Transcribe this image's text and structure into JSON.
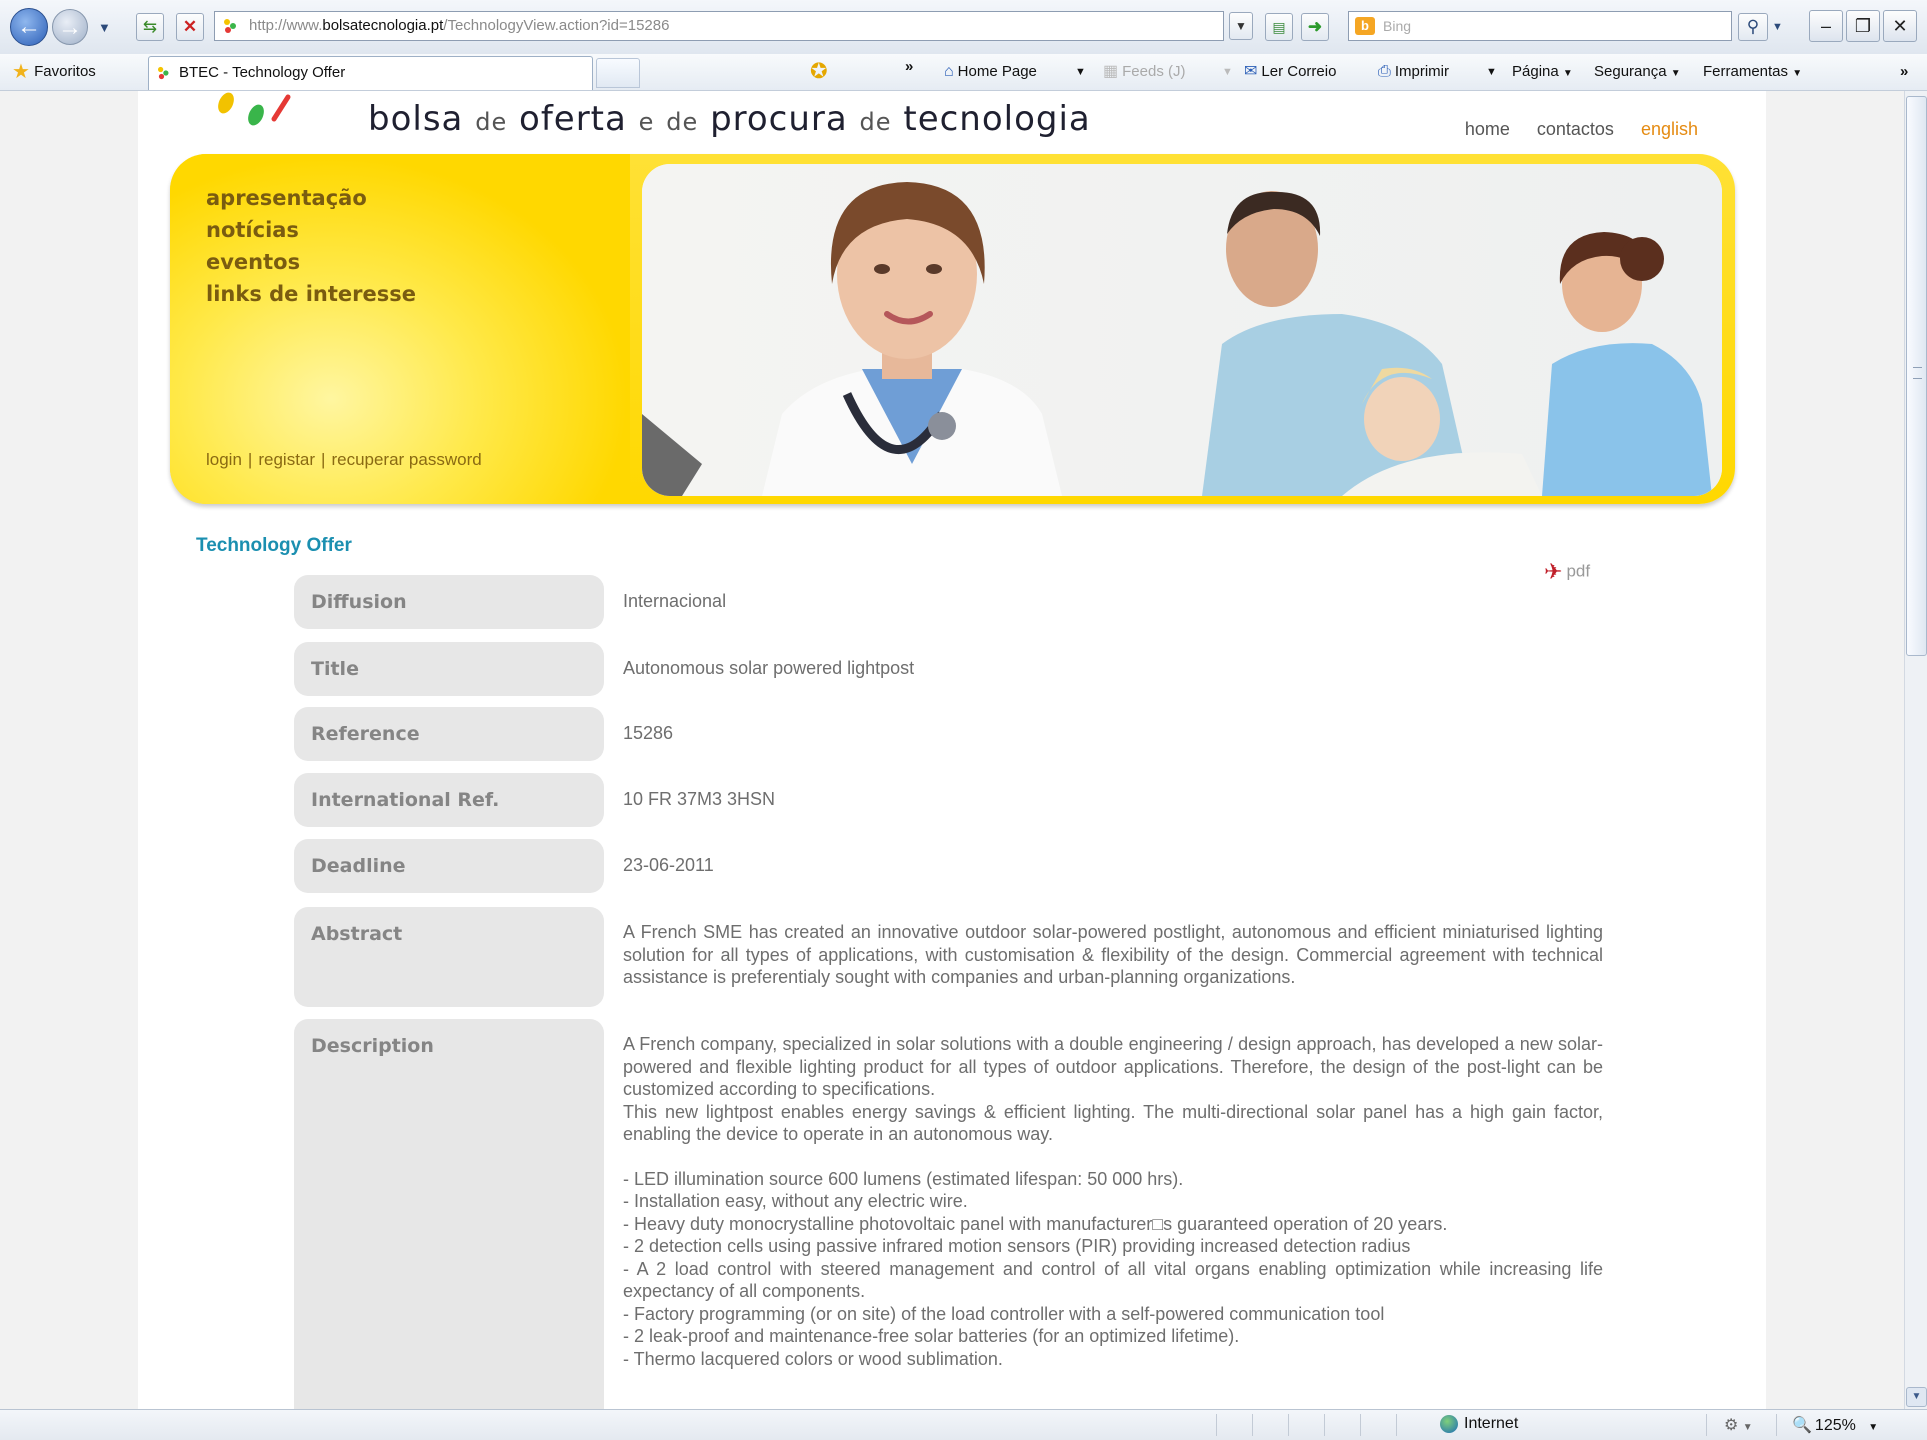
{
  "browser": {
    "url_prefix": "http://www.",
    "url_host": "bolsatecnologia.pt",
    "url_path": "/TechnologyView.action?id=15286",
    "search_placeholder": "Bing",
    "search_logo": "b",
    "favorites_label": "Favoritos",
    "tab_title": "BTEC - Technology Offer",
    "more_chevron": "»",
    "commands": {
      "home_page": "Home Page",
      "feeds": "Feeds (J)",
      "read_mail": "Ler Correio",
      "print": "Imprimir",
      "page": "Página",
      "safety": "Segurança",
      "tools": "Ferramentas"
    },
    "icons": [
      "back-arrow-icon",
      "forward-arrow-icon",
      "refresh-icon",
      "stop-icon",
      "compat-view-icon",
      "go-arrow-icon",
      "search-icon",
      "star-icon",
      "add-favorite-icon",
      "home-icon",
      "feeds-icon",
      "mail-icon",
      "printer-icon",
      "globe-icon",
      "zoom-icon"
    ]
  },
  "site": {
    "title_words": [
      "bolsa",
      "de",
      "oferta",
      "e",
      "de",
      "procura",
      "de",
      "tecnologia"
    ],
    "top_links": {
      "home": "home",
      "contacts": "contactos",
      "english": "english"
    },
    "menu": [
      "apresentação",
      "notícias",
      "eventos",
      "links de interesse"
    ],
    "auth": {
      "login": "login",
      "register": "registar",
      "recover": "recuperar password"
    },
    "accent_colors": {
      "banner_yellow": "#ffd800",
      "section_title": "#1b8fb0",
      "active_link": "#e58b12"
    }
  },
  "offer": {
    "section_title": "Technology Offer",
    "pdf_label": "pdf",
    "fields": {
      "diffusion": {
        "label": "Diffusion",
        "value": "Internacional"
      },
      "title": {
        "label": "Title",
        "value": "Autonomous solar powered lightpost"
      },
      "reference": {
        "label": "Reference",
        "value": "15286"
      },
      "international_ref": {
        "label": "International Ref.",
        "value": "10 FR 37M3 3HSN"
      },
      "deadline": {
        "label": "Deadline",
        "value": "23-06-2011"
      },
      "abstract": {
        "label": "Abstract",
        "value": "A French SME has created an innovative outdoor solar-powered postlight, autonomous and efficient miniaturised lighting solution for all types of applications, with customisation & flexibility of the design. Commercial agreement with technical assistance is preferentialy sought with companies and urban-planning organizations."
      },
      "description": {
        "label": "Description",
        "para1": "A French company, specialized in solar solutions with a double engineering / design approach, has developed a new solar-powered and flexible lighting product for all types of outdoor applications. Therefore, the design of the post-light can be customized according to specifications.",
        "para2": "This new lightpost enables energy savings & efficient lighting. The multi-directional solar panel has a high gain factor, enabling the device to operate in an autonomous way.",
        "bullets": [
          "- LED illumination source 600 lumens (estimated lifespan: 50 000 hrs).",
          "- Installation easy, without any electric wire.",
          "- Heavy duty monocrystalline photovoltaic panel with manufacturer□s guaranteed operation of 20 years.",
          "- 2 detection cells using passive infrared motion sensors (PIR) providing increased detection radius",
          "- A 2 load control with steered management and control of all vital organs enabling optimization while increasing life expectancy of all components.",
          "- Factory programming (or on site) of the load controller with a self-powered communication tool",
          "- 2 leak-proof and maintenance-free solar batteries (for an optimized lifetime).",
          "- Thermo lacquered colors or wood sublimation."
        ]
      }
    }
  },
  "status": {
    "zone": "Internet",
    "zoom": "125%"
  }
}
